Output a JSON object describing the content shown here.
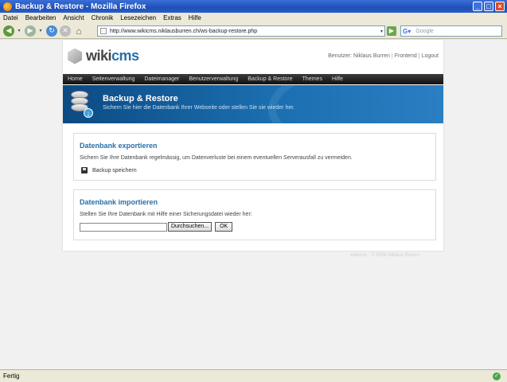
{
  "window": {
    "title": "Backup & Restore - Mozilla Firefox",
    "minimize": "_",
    "maximize": "□",
    "close": "×"
  },
  "menu": [
    "Datei",
    "Bearbeiten",
    "Ansicht",
    "Chronik",
    "Lesezeichen",
    "Extras",
    "Hilfe"
  ],
  "toolbar": {
    "url": "http://www.wikicms.niklausburren.ch/ws-backup-restore.php",
    "search_placeholder": "Google"
  },
  "site": {
    "logo_wiki": "wiki",
    "logo_cms": "cms",
    "user_label": "Benutzer: Niklaus Burren",
    "frontend_link": "Frontend",
    "logout_link": "Logout",
    "nav": [
      "Home",
      "Seitenverwaltung",
      "Dateimanager",
      "Benutzerverwaltung",
      "Backup & Restore",
      "Themes",
      "Hilfe"
    ]
  },
  "banner": {
    "title": "Backup & Restore",
    "subtitle": "Sichern Sie hier die Datenbank Ihrer Webseite oder stellen Sie sie wieder her."
  },
  "export": {
    "heading": "Datenbank exportieren",
    "text": "Sichern Sie Ihre Datenbank regelmässig, um Datenverluste bei einem eventuellen Serverausfall zu vermeiden.",
    "link": "Backup speichern"
  },
  "import": {
    "heading": "Datenbank importieren",
    "text": "Stellen Sie Ihre Datenbank mit Hilfe einer Sicherungsdatei wieder her:",
    "browse_button": "Durchsuchen...",
    "ok_button": "OK"
  },
  "footer": {
    "note": "wikicms · © 2008 Niklaus Burren"
  },
  "status": {
    "text": "Fertig"
  }
}
